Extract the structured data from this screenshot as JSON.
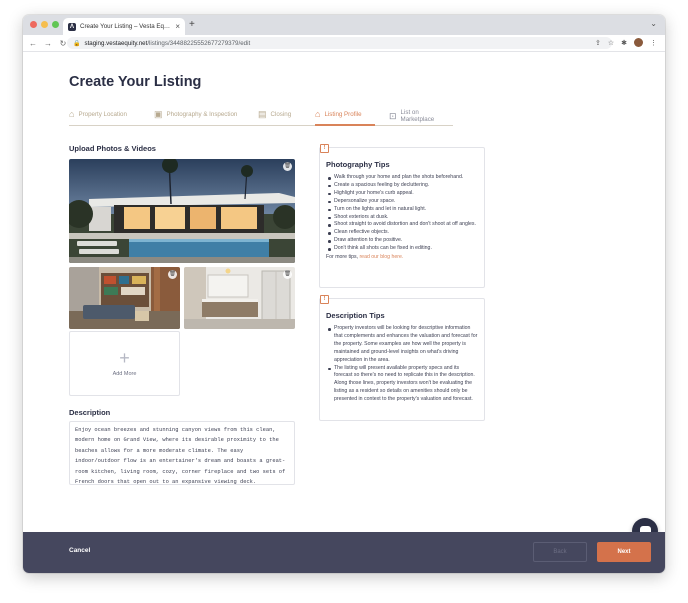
{
  "browser": {
    "tab_title": "Create Your Listing – Vesta Eq…",
    "url_host": "staging.vestaequity.net",
    "url_path": "/listings/34488225552677279379/edit"
  },
  "page": {
    "title": "Create Your Listing"
  },
  "steps": [
    {
      "label": "Property Location",
      "state": "complete",
      "icon": "house-icon"
    },
    {
      "label": "Photography & Inspection",
      "state": "complete",
      "icon": "image-icon"
    },
    {
      "label": "Closing",
      "state": "complete",
      "icon": "document-icon"
    },
    {
      "label": "Listing Profile",
      "state": "active",
      "icon": "building-icon"
    },
    {
      "label": "List on Marketplace",
      "state": "inactive",
      "icon": "storefront-icon"
    }
  ],
  "upload": {
    "title": "Upload Photos & Videos",
    "add_more_label": "Add More"
  },
  "description": {
    "title": "Description",
    "text": "Enjoy ocean breezes and stunning canyon views from this clean, modern home on Grand View, where its desirable proximity to the beaches allows for a more moderate climate. The easy indoor/outdoor flow is an entertainer's dream and boasts a great-room kitchen, living room, cozy, corner fireplace and two sets of French doors that open out to an expansive viewing deck."
  },
  "photography_tips": {
    "title": "Photography Tips",
    "items": [
      "Walk through your home and plan the shots beforehand.",
      "Create a spacious feeling by decluttering.",
      "Highlight your home's curb appeal.",
      "Depersonalize your space.",
      "Turn on the lights and let in natural light.",
      "Shoot exteriors at dusk.",
      "Shoot straight to avoid distortion and don't shoot at off angles.",
      "Clean reflective objects.",
      "Draw attention to the positive.",
      "Don't think all shots can be fixed in editing."
    ],
    "footer_prefix": "For more tips, ",
    "footer_link": "read our blog here."
  },
  "description_tips": {
    "title": "Description Tips",
    "items": [
      "Property investors will be looking for descriptive information that complements and enhances the valuation and forecast for the property. Some examples are how well the property is maintained and ground-level insights on what's driving appreciation in the area.",
      "The listing will present available property specs and its forecast so there's no need to replicate this in the description. Along those lines, property investors won't be evaluating the listing as a resident so details on amenities should only be presented in context to the property's valuation and forecast."
    ]
  },
  "footer": {
    "cancel_label": "Cancel",
    "back_label": "Back",
    "next_label": "Next"
  },
  "colors": {
    "accent": "#d4724b",
    "navy": "#2b2f45",
    "footer_bg": "#45475e"
  }
}
